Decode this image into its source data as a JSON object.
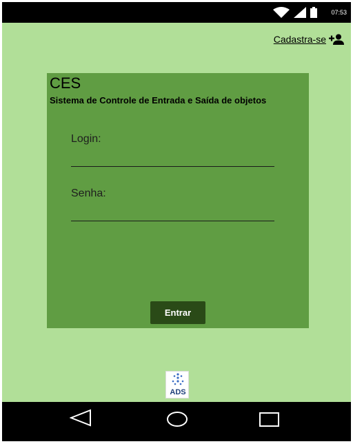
{
  "status_bar": {
    "time": "07:53",
    "icons": [
      "wifi-icon",
      "signal-icon",
      "battery-icon"
    ]
  },
  "header": {
    "signup_label": "Cadastra-se",
    "signup_icon": "person-add-icon"
  },
  "login_card": {
    "title": "CES",
    "subtitle": "Sistema de Controle de Entrada e Saída de objetos",
    "login_label": "Login:",
    "login_value": "",
    "password_label": "Senha:",
    "password_value": "",
    "submit_label": "Entrar"
  },
  "footer": {
    "logo_text": "ADS"
  },
  "nav_bar": {
    "buttons": [
      "back-icon",
      "home-icon",
      "recents-icon"
    ]
  },
  "colors": {
    "background": "#b1df98",
    "card": "#609d43",
    "button": "#2a4a17",
    "system_bars": "#000000"
  }
}
